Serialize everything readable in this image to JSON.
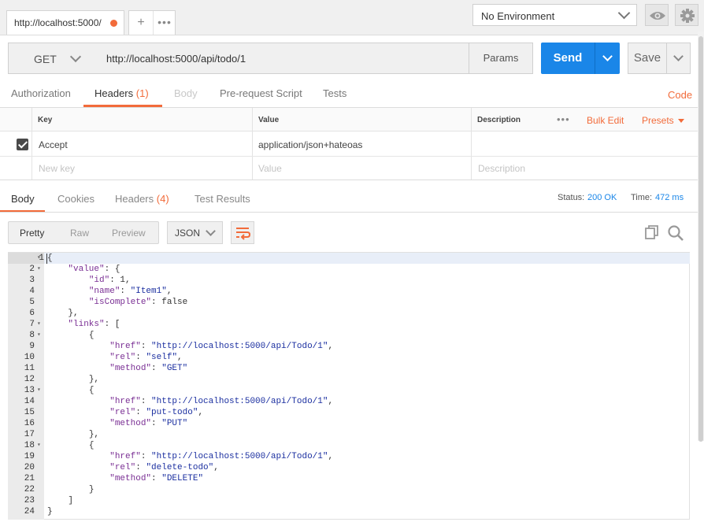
{
  "tabs": {
    "request_tab_title": "http://localhost:5000/",
    "add_label": "+",
    "more_label": "•••"
  },
  "environment": {
    "selected": "No Environment"
  },
  "request": {
    "method": "GET",
    "url": "http://localhost:5000/api/todo/1",
    "params_label": "Params",
    "send_label": "Send",
    "save_label": "Save"
  },
  "request_tabs": {
    "authorization": "Authorization",
    "headers": "Headers",
    "headers_count": "(1)",
    "body": "Body",
    "prerequest": "Pre-request Script",
    "tests": "Tests",
    "code": "Code"
  },
  "headers_table": {
    "col_key": "Key",
    "col_value": "Value",
    "col_description": "Description",
    "more": "•••",
    "bulk_edit": "Bulk Edit",
    "presets": "Presets",
    "rows": [
      {
        "key": "Accept",
        "value": "application/json+hateoas",
        "checked": true
      }
    ],
    "placeholder_key": "New key",
    "placeholder_value": "Value",
    "placeholder_description": "Description"
  },
  "response_tabs": {
    "body": "Body",
    "cookies": "Cookies",
    "headers": "Headers",
    "headers_count": "(4)",
    "test_results": "Test Results",
    "status_label": "Status:",
    "status_value": "200 OK",
    "time_label": "Time:",
    "time_value": "472 ms"
  },
  "view_toolbar": {
    "pretty": "Pretty",
    "raw": "Raw",
    "preview": "Preview",
    "format": "JSON"
  },
  "icons": [
    "eye-icon",
    "gear-icon",
    "wrap-lines-icon",
    "copy-icon",
    "search-icon",
    "checkbox-checked-icon"
  ],
  "colors": {
    "accent": "#f26b3a",
    "send": "#1a86e8",
    "status": "#1a86e8"
  },
  "response_body": [
    {
      "n": "1",
      "fold": true,
      "indent": 0,
      "t": [
        [
          "p",
          "{"
        ]
      ]
    },
    {
      "n": "2",
      "fold": true,
      "indent": 1,
      "t": [
        [
          "k",
          "\"value\""
        ],
        [
          "p",
          ": {"
        ]
      ]
    },
    {
      "n": "3",
      "fold": false,
      "indent": 2,
      "t": [
        [
          "k",
          "\"id\""
        ],
        [
          "p",
          ": 1,"
        ]
      ]
    },
    {
      "n": "4",
      "fold": false,
      "indent": 2,
      "t": [
        [
          "k",
          "\"name\""
        ],
        [
          "p",
          ": "
        ],
        [
          "s",
          "\"Item1\""
        ],
        [
          "p",
          ","
        ]
      ]
    },
    {
      "n": "5",
      "fold": false,
      "indent": 2,
      "t": [
        [
          "k",
          "\"isComplete\""
        ],
        [
          "p",
          ": false"
        ]
      ]
    },
    {
      "n": "6",
      "fold": false,
      "indent": 1,
      "t": [
        [
          "p",
          "},"
        ]
      ]
    },
    {
      "n": "7",
      "fold": true,
      "indent": 1,
      "t": [
        [
          "k",
          "\"links\""
        ],
        [
          "p",
          ": ["
        ]
      ]
    },
    {
      "n": "8",
      "fold": true,
      "indent": 2,
      "t": [
        [
          "p",
          "{"
        ]
      ]
    },
    {
      "n": "9",
      "fold": false,
      "indent": 3,
      "t": [
        [
          "k",
          "\"href\""
        ],
        [
          "p",
          ": "
        ],
        [
          "s",
          "\"http://localhost:5000/api/Todo/1\""
        ],
        [
          "p",
          ","
        ]
      ]
    },
    {
      "n": "10",
      "fold": false,
      "indent": 3,
      "t": [
        [
          "k",
          "\"rel\""
        ],
        [
          "p",
          ": "
        ],
        [
          "s",
          "\"self\""
        ],
        [
          "p",
          ","
        ]
      ]
    },
    {
      "n": "11",
      "fold": false,
      "indent": 3,
      "t": [
        [
          "k",
          "\"method\""
        ],
        [
          "p",
          ": "
        ],
        [
          "s",
          "\"GET\""
        ]
      ]
    },
    {
      "n": "12",
      "fold": false,
      "indent": 2,
      "t": [
        [
          "p",
          "},"
        ]
      ]
    },
    {
      "n": "13",
      "fold": true,
      "indent": 2,
      "t": [
        [
          "p",
          "{"
        ]
      ]
    },
    {
      "n": "14",
      "fold": false,
      "indent": 3,
      "t": [
        [
          "k",
          "\"href\""
        ],
        [
          "p",
          ": "
        ],
        [
          "s",
          "\"http://localhost:5000/api/Todo/1\""
        ],
        [
          "p",
          ","
        ]
      ]
    },
    {
      "n": "15",
      "fold": false,
      "indent": 3,
      "t": [
        [
          "k",
          "\"rel\""
        ],
        [
          "p",
          ": "
        ],
        [
          "s",
          "\"put-todo\""
        ],
        [
          "p",
          ","
        ]
      ]
    },
    {
      "n": "16",
      "fold": false,
      "indent": 3,
      "t": [
        [
          "k",
          "\"method\""
        ],
        [
          "p",
          ": "
        ],
        [
          "s",
          "\"PUT\""
        ]
      ]
    },
    {
      "n": "17",
      "fold": false,
      "indent": 2,
      "t": [
        [
          "p",
          "},"
        ]
      ]
    },
    {
      "n": "18",
      "fold": true,
      "indent": 2,
      "t": [
        [
          "p",
          "{"
        ]
      ]
    },
    {
      "n": "19",
      "fold": false,
      "indent": 3,
      "t": [
        [
          "k",
          "\"href\""
        ],
        [
          "p",
          ": "
        ],
        [
          "s",
          "\"http://localhost:5000/api/Todo/1\""
        ],
        [
          "p",
          ","
        ]
      ]
    },
    {
      "n": "20",
      "fold": false,
      "indent": 3,
      "t": [
        [
          "k",
          "\"rel\""
        ],
        [
          "p",
          ": "
        ],
        [
          "s",
          "\"delete-todo\""
        ],
        [
          "p",
          ","
        ]
      ]
    },
    {
      "n": "21",
      "fold": false,
      "indent": 3,
      "t": [
        [
          "k",
          "\"method\""
        ],
        [
          "p",
          ": "
        ],
        [
          "s",
          "\"DELETE\""
        ]
      ]
    },
    {
      "n": "22",
      "fold": false,
      "indent": 2,
      "t": [
        [
          "p",
          "}"
        ]
      ]
    },
    {
      "n": "23",
      "fold": false,
      "indent": 1,
      "t": [
        [
          "p",
          "]"
        ]
      ]
    },
    {
      "n": "24",
      "fold": false,
      "indent": 0,
      "t": [
        [
          "p",
          "}"
        ]
      ]
    }
  ]
}
